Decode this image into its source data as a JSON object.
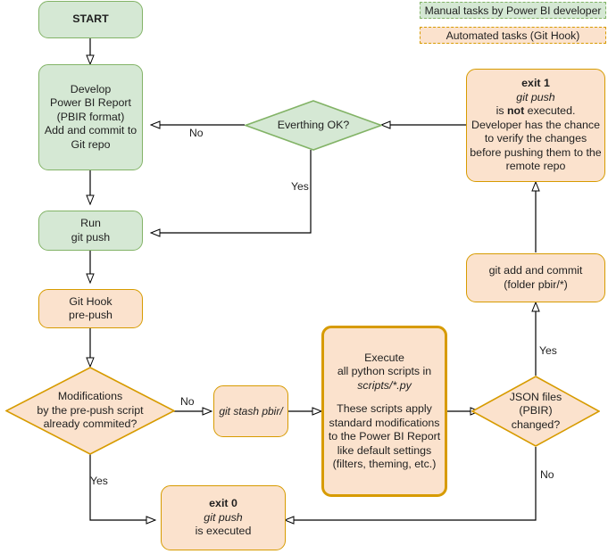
{
  "diagram": {
    "title": "Power BI PBIR Git Hook Flowchart",
    "colors": {
      "green_fill": "#d5e8d4",
      "green_stroke": "#82b366",
      "orange_fill": "#fbe2cd",
      "orange_stroke": "#d79b00",
      "edge_stroke": "#000000",
      "text": "#1f1f1f"
    }
  },
  "legend": {
    "items": [
      {
        "label": "Manual tasks by Power BI developer",
        "style": "green-dashed"
      },
      {
        "label": "Automated tasks (Git Hook)",
        "style": "orange-dashed"
      }
    ]
  },
  "nodes": {
    "start": {
      "label": "START",
      "shape": "rounded",
      "style": "green"
    },
    "develop": {
      "label": "Develop\nPower BI Report\n(PBIR format)\nAdd and commit to\nGit repo",
      "shape": "rounded",
      "style": "green"
    },
    "everything_ok": {
      "label": "Everthing OK?",
      "shape": "diamond",
      "style": "green"
    },
    "exit1_l1": "exit 1",
    "exit1_l2": "git push",
    "exit1_l3a": "is ",
    "exit1_l3b": "not",
    "exit1_l3c": " executed.",
    "exit1_l4": "Developer has the chance",
    "exit1_l5": "to verify the changes",
    "exit1_l6": "before pushing them to the",
    "exit1_l7": "remote repo",
    "run_git_push": {
      "label": "Run\ngit push",
      "shape": "rounded",
      "style": "green"
    },
    "git_hook": {
      "label": "Git Hook\npre-push",
      "shape": "rounded",
      "style": "orange"
    },
    "modifications": {
      "label": "Modifications\nby the pre-push script\nalready commited?",
      "shape": "diamond",
      "style": "orange"
    },
    "git_stash": {
      "label": "git stash pbir/",
      "shape": "rounded",
      "style": "orange"
    },
    "execute_l1": "Execute",
    "execute_l2": "all python scripts in",
    "execute_l3": "scripts/*.py",
    "execute_l4": "These scripts apply",
    "execute_l5": "standard modifications",
    "execute_l6": "to the Power BI Report",
    "execute_l7": "like default settings",
    "execute_l8": "(filters, theming, etc.)",
    "json_changed": {
      "label": "JSON files\n(PBIR)\nchanged?",
      "shape": "diamond",
      "style": "orange"
    },
    "git_add_commit": {
      "label": "git add and commit\n(folder pbir/*)",
      "shape": "rounded",
      "style": "orange"
    },
    "exit0_l1": "exit 0",
    "exit0_l2": "git push",
    "exit0_l3": "is executed"
  },
  "edge_labels": {
    "ok_no": "No",
    "ok_yes": "Yes",
    "mod_no": "No",
    "mod_yes": "Yes",
    "json_yes": "Yes",
    "json_no": "No"
  }
}
